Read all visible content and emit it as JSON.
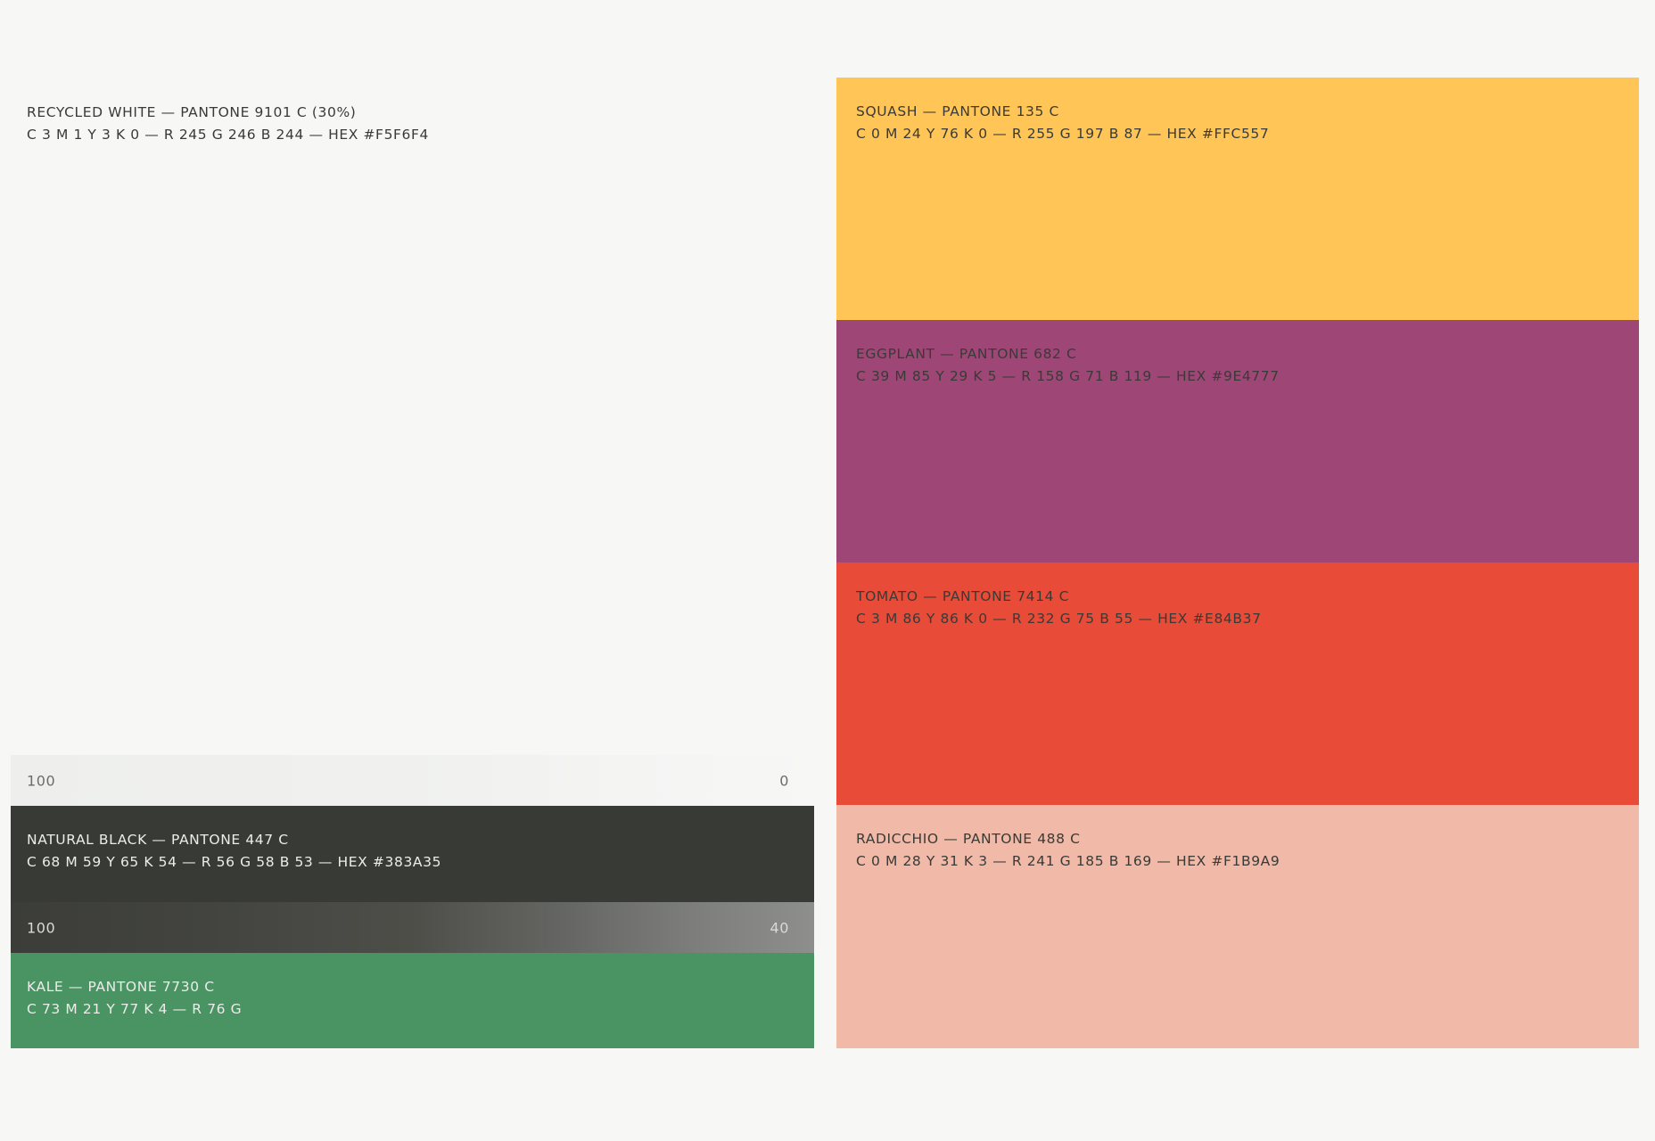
{
  "swatches": {
    "recycled_white": {
      "line1": "RECYCLED WHITE  —  PANTONE 9101 C (30%)",
      "line2": "C 3  M 1  Y 3  K 0  —  R 245 G 246 B 244  —  HEX #F5F6F4",
      "color": "#F5F6F4"
    },
    "white_ramp": {
      "start": "100",
      "end": "0"
    },
    "natural_black": {
      "line1": "NATURAL BLACK  —  PANTONE 447 C",
      "line2": "C 68  M 59  Y 65  K 54  —  R 56  G 58  B 53  —  HEX #383A35",
      "color": "#383A35"
    },
    "black_ramp": {
      "start": "100",
      "end": "40"
    },
    "kale": {
      "line1": "KALE  —  PANTONE 7730 C",
      "line2": "C 73  M 21  Y 77  K 4  —  R 76  G",
      "color": "#4A9463"
    },
    "squash": {
      "line1": "SQUASH  —  PANTONE 135 C",
      "line2": "C 0  M 24  Y 76  K 0  —  R 255 G 197 B 87  —  HEX #FFC557",
      "color": "#FFC557"
    },
    "eggplant": {
      "line1": "EGGPLANT  —  PANTONE 682 C",
      "line2": "C 39  M 85  Y 29  K 5  —  R 158  G 71  B 119  —  HEX #9E4777",
      "color": "#9E4777"
    },
    "tomato": {
      "line1": "TOMATO  —  PANTONE 7414 C",
      "line2": "C 3  M 86  Y 86  K 0  —  R 232  G 75  B 55  —  HEX #E84B37",
      "color": "#E84B37"
    },
    "radicchio": {
      "line1": "RADICCHIO  —  PANTONE 488 C",
      "line2": "C 0  M 28  Y 31  K 3  —  R 241  G 185  B 169  —  HEX #F1B9A9",
      "color": "#F1B9A9"
    }
  }
}
